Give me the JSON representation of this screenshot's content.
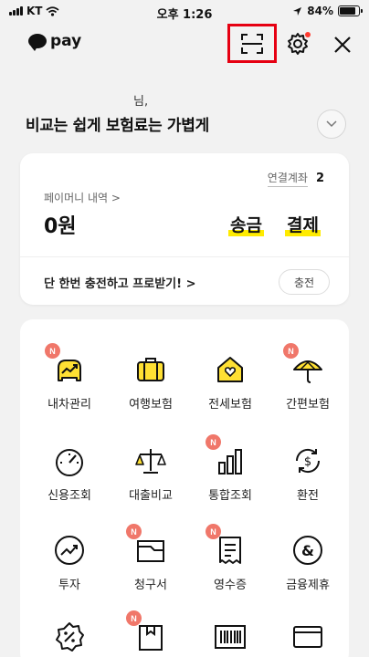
{
  "status_bar": {
    "carrier": "KT",
    "time": "오후 1:26",
    "battery": "84%",
    "battery_level": 0.84
  },
  "header": {
    "logo_text": "pay"
  },
  "greeting": {
    "name_suffix": "님,",
    "headline": "비교는 쉽게 보험료는 가볍게"
  },
  "money": {
    "linked_accounts_label": "연결계좌",
    "linked_accounts_count": "2",
    "history_label": "페이머니 내역 >",
    "balance": "0원",
    "send_label": "송금",
    "pay_label": "결제",
    "promo_text": "단 한번 충전하고 프로받기! >",
    "charge_label": "충전"
  },
  "services": [
    {
      "label": "내차관리",
      "icon": "car-manage-icon",
      "badge": "N"
    },
    {
      "label": "여행보험",
      "icon": "suitcase-icon",
      "badge": ""
    },
    {
      "label": "전세보험",
      "icon": "house-heart-icon",
      "badge": ""
    },
    {
      "label": "간편보험",
      "icon": "umbrella-icon",
      "badge": "N"
    },
    {
      "label": "신용조회",
      "icon": "gauge-icon",
      "badge": ""
    },
    {
      "label": "대출비교",
      "icon": "scale-icon",
      "badge": ""
    },
    {
      "label": "통합조회",
      "icon": "bar-chart-icon",
      "badge": "N"
    },
    {
      "label": "환전",
      "icon": "exchange-icon",
      "badge": ""
    },
    {
      "label": "투자",
      "icon": "invest-icon",
      "badge": ""
    },
    {
      "label": "청구서",
      "icon": "bill-envelope-icon",
      "badge": "N"
    },
    {
      "label": "영수증",
      "icon": "receipt-icon",
      "badge": "N"
    },
    {
      "label": "금융제휴",
      "icon": "ampersand-icon",
      "badge": ""
    },
    {
      "label": "",
      "icon": "coupon-icon",
      "badge": ""
    },
    {
      "label": "",
      "icon": "box-icon",
      "badge": "N"
    },
    {
      "label": "",
      "icon": "barcode-icon",
      "badge": ""
    },
    {
      "label": "",
      "icon": "card-icon",
      "badge": ""
    }
  ],
  "colors": {
    "accent_yellow": "#ffeb00",
    "badge_red": "#f0776a",
    "highlight_box": "#e60012"
  }
}
